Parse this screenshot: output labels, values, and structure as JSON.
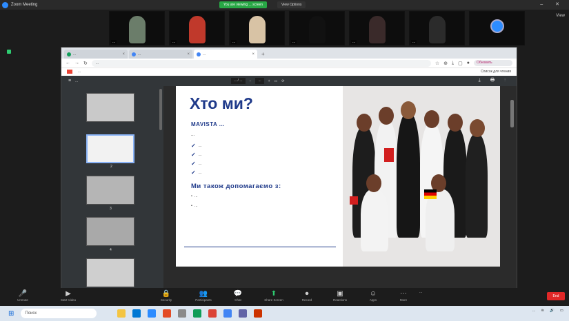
{
  "window": {
    "title": "Zoom Meeting",
    "sharing_banner": "You are viewing ... screen",
    "view_options": "View Options",
    "gallery": "View"
  },
  "participants": [
    {
      "name": "...",
      "face_color": "#6b7d6a"
    },
    {
      "name": "...",
      "face_color": "#c0392b"
    },
    {
      "name": "...",
      "face_color": "#d8c3a5"
    },
    {
      "name": "...",
      "face_color": "#111111"
    },
    {
      "name": "...",
      "face_color": "#3a2a2a"
    },
    {
      "name": "...",
      "face_color": "#2b2b2b"
    },
    {
      "name": "...",
      "face_color": "#2d8cff"
    }
  ],
  "browser": {
    "tabs": [
      {
        "label": "...",
        "color": "#0f9d58"
      },
      {
        "label": "...",
        "color": "#4285f4"
      },
      {
        "label": "...",
        "color": "#4285f4"
      }
    ],
    "url": "...",
    "update_label": "Обновить",
    "bookmarks": [
      "Gmail",
      "..."
    ],
    "reading_list": "Список для чтения"
  },
  "viewer": {
    "file_name": "...",
    "page_info": "... / ...",
    "zoom": "...",
    "thumb_numbers": [
      "",
      "2",
      "3",
      "4",
      ""
    ]
  },
  "slide": {
    "title": "Хто ми?",
    "tagline": "MAVISTA ...",
    "intro": "...",
    "checks": [
      "...",
      "...",
      "...",
      "..."
    ],
    "subtitle": "Ми також допомагаємо з:",
    "bullets": [
      "...",
      "..."
    ]
  },
  "toolbar": {
    "items": [
      {
        "icon": "🎤",
        "label": "Unmute"
      },
      {
        "icon": "▶",
        "label": "Start Video"
      },
      {
        "icon": "🔒",
        "label": "Security"
      },
      {
        "icon": "👥",
        "label": "Participants"
      },
      {
        "icon": "💬",
        "label": "Chat"
      },
      {
        "icon": "⬆",
        "label": "Share Screen"
      },
      {
        "icon": "⏺",
        "label": "Record"
      },
      {
        "icon": "▣",
        "label": "Reactions"
      },
      {
        "icon": "☺",
        "label": "Apps"
      },
      {
        "icon": "⋯",
        "label": "More"
      }
    ],
    "end": "End",
    "status": "..."
  },
  "taskbar": {
    "search_placeholder": "Поиск",
    "apps": [
      "#f4c542",
      "#0078d4",
      "#2d8cff",
      "#e34c26",
      "#8a8a8a",
      "#0f9d58",
      "#db4437",
      "#4285f4",
      "#6264a7",
      "#cc3300"
    ],
    "tray": "..."
  },
  "colors": {
    "accent": "#1f3a8a",
    "zoom_blue": "#2d8cff",
    "end_red": "#e02828",
    "share_green": "#28a745"
  }
}
